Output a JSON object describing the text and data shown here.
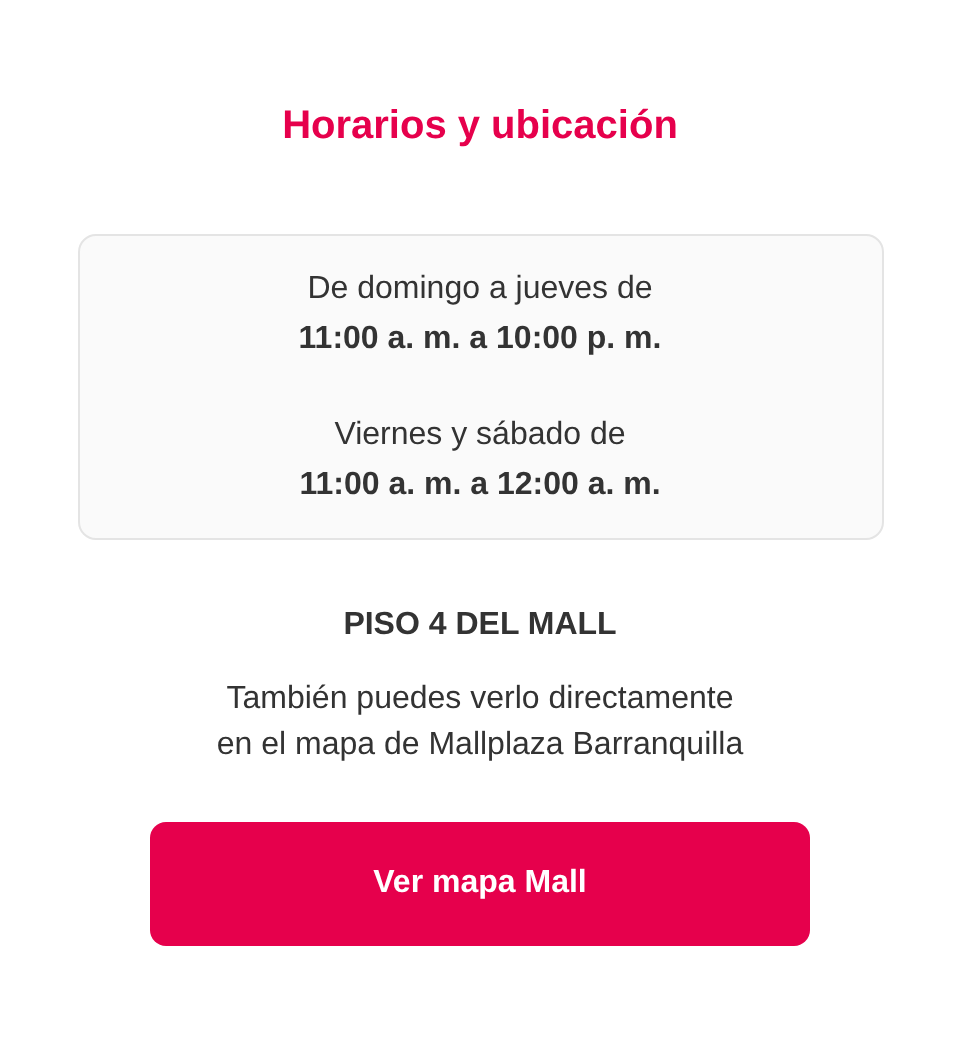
{
  "title": "Horarios y ubicación",
  "schedule": [
    {
      "days": "De domingo a jueves de",
      "hours": "11:00 a. m. a 10:00 p. m."
    },
    {
      "days": "Viernes y sábado de",
      "hours": "11:00 a. m. a 12:00 a. m."
    }
  ],
  "location": {
    "floor": "PISO 4 DEL MALL",
    "description": "También puedes verlo directamente\nen el mapa de Mallplaza Barranquilla"
  },
  "button": {
    "label": "Ver mapa Mall"
  }
}
